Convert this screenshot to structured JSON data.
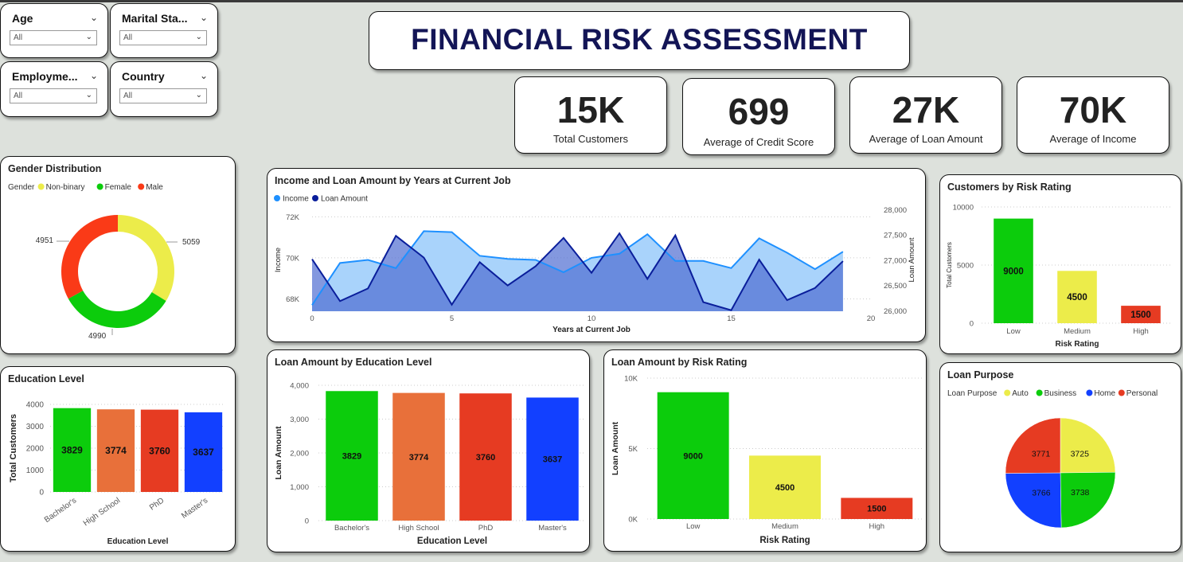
{
  "header": {
    "title": "FINANCIAL RISK ASSESSMENT"
  },
  "slicers": [
    {
      "title": "Age",
      "value": "All"
    },
    {
      "title": "Marital Sta...",
      "value": "All"
    },
    {
      "title": "Employme...",
      "value": "All"
    },
    {
      "title": "Country",
      "value": "All"
    }
  ],
  "kpis": [
    {
      "value": "15K",
      "label": "Total Customers"
    },
    {
      "value": "699",
      "label": "Average of Credit Score"
    },
    {
      "value": "27K",
      "label": "Average of Loan Amount"
    },
    {
      "value": "70K",
      "label": "Average of Income"
    }
  ],
  "chart_data": [
    {
      "id": "gender",
      "type": "pie",
      "title": "Gender Distribution",
      "legend_title": "Gender",
      "legend_position": "top-left",
      "categories": [
        "Non-binary",
        "Female",
        "Male"
      ],
      "values": [
        5059,
        4990,
        4951
      ],
      "colors": [
        "#ecec4a",
        "#0ccc0c",
        "#fa3a17"
      ]
    },
    {
      "id": "income_loan",
      "type": "area",
      "title": "Income and Loan Amount by Years at Current Job",
      "xlabel": "Years at Current Job",
      "ylabel": "Income",
      "y2label": "Loan Amount",
      "x": [
        0,
        1,
        2,
        3,
        4,
        5,
        6,
        7,
        8,
        9,
        10,
        11,
        12,
        13,
        14,
        15,
        16,
        17,
        18,
        19
      ],
      "xticks": [
        0,
        5,
        10,
        15,
        20
      ],
      "xlim": [
        0,
        20
      ],
      "yticks": [
        "68K",
        "70K",
        "72K"
      ],
      "ylim": [
        67400,
        72400
      ],
      "y2ticks": [
        "26,000",
        "26,500",
        "27,000",
        "27,500",
        "28,000"
      ],
      "y2lim": [
        25990,
        28020
      ],
      "series": [
        {
          "name": "Income",
          "axis": "left",
          "color": "#1e90ff",
          "values": [
            67700,
            69750,
            69900,
            69500,
            71300,
            71250,
            70100,
            69950,
            69900,
            69300,
            70000,
            70200,
            71150,
            69850,
            69850,
            69500,
            70950,
            70250,
            69450,
            70300
          ]
        },
        {
          "name": "Loan Amount",
          "axis": "right",
          "color": "#0a1e9b",
          "values": [
            27020,
            26190,
            26440,
            27480,
            27050,
            26120,
            26960,
            26500,
            26880,
            27440,
            26750,
            27530,
            26630,
            27490,
            26170,
            26010,
            27010,
            26210,
            26450,
            26980
          ]
        }
      ]
    },
    {
      "id": "risk_customers",
      "type": "bar",
      "title": "Customers by Risk Rating",
      "xlabel": "Risk Rating",
      "ylabel": "Total Customers",
      "categories": [
        "Low",
        "Medium",
        "High"
      ],
      "values": [
        9000,
        4500,
        1500
      ],
      "colors": [
        "#0ccc0c",
        "#ecec4a",
        "#e63b22"
      ],
      "yticks": [
        "0",
        "5000",
        "10000"
      ],
      "ylim": [
        0,
        10000
      ]
    },
    {
      "id": "education_customers",
      "type": "bar",
      "title": "Education Level",
      "xlabel": "Education Level",
      "ylabel": "Total Customers",
      "categories": [
        "Bachelor's",
        "High School",
        "PhD",
        "Master's"
      ],
      "values": [
        3829,
        3774,
        3760,
        3637
      ],
      "colors": [
        "#0ccc0c",
        "#e8703a",
        "#e63b22",
        "#1240ff"
      ],
      "yticks": [
        "0",
        "1000",
        "2000",
        "3000",
        "4000"
      ],
      "ylim": [
        0,
        4000
      ]
    },
    {
      "id": "education_loan",
      "type": "bar",
      "title": "Loan Amount by Education Level",
      "xlabel": "Education Level",
      "ylabel": "Loan Amount",
      "categories": [
        "Bachelor's",
        "High School",
        "PhD",
        "Master's"
      ],
      "values": [
        3829,
        3774,
        3760,
        3637
      ],
      "colors": [
        "#0ccc0c",
        "#e8703a",
        "#e63b22",
        "#1240ff"
      ],
      "yticks": [
        "0",
        "1,000",
        "2,000",
        "3,000",
        "4,000"
      ],
      "ylim": [
        0,
        4000
      ]
    },
    {
      "id": "risk_loan",
      "type": "bar",
      "title": "Loan Amount by Risk Rating",
      "xlabel": "Risk Rating",
      "ylabel": "Loan Amount",
      "categories": [
        "Low",
        "Medium",
        "High"
      ],
      "values": [
        9000,
        4500,
        1500
      ],
      "colors": [
        "#0ccc0c",
        "#ecec4a",
        "#e63b22"
      ],
      "yticks": [
        "0K",
        "5K",
        "10K"
      ],
      "ylim": [
        0,
        10000
      ]
    },
    {
      "id": "purpose",
      "type": "pie",
      "title": "Loan Purpose",
      "legend_title": "Loan Purpose",
      "legend_position": "top-left",
      "categories": [
        "Auto",
        "Business",
        "Home",
        "Personal"
      ],
      "values": [
        3725,
        3738,
        3766,
        3771
      ],
      "colors": [
        "#ecec4a",
        "#0ccc0c",
        "#1240ff",
        "#e63b22"
      ]
    }
  ]
}
